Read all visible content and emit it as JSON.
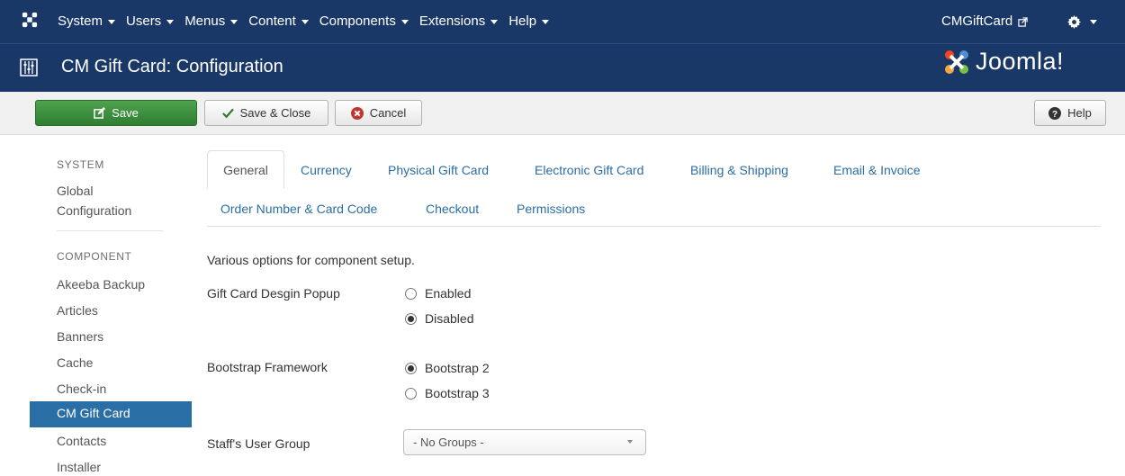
{
  "topnav": {
    "menu": [
      {
        "label": "System"
      },
      {
        "label": "Users"
      },
      {
        "label": "Menus"
      },
      {
        "label": "Content"
      },
      {
        "label": "Components"
      },
      {
        "label": "Extensions"
      },
      {
        "label": "Help"
      }
    ],
    "user_label": "CMGiftCard"
  },
  "titlebar": {
    "title": "CM Gift Card: Configuration",
    "brand": "Joomla!"
  },
  "toolbar": {
    "save_label": "Save",
    "save_close_label": "Save & Close",
    "cancel_label": "Cancel",
    "help_label": "Help"
  },
  "sidebar": {
    "system_heading": "SYSTEM",
    "global_config": [
      "Global",
      "Configuration"
    ],
    "component_heading": "COMPONENT",
    "items": [
      "Akeeba Backup",
      "Articles",
      "Banners",
      "Cache",
      "Check-in",
      "CM Gift Card",
      "Contacts",
      "Installer"
    ]
  },
  "tabs": {
    "row1": [
      "General",
      "Currency",
      "Physical Gift Card",
      "Electronic Gift Card",
      "Billing & Shipping",
      "Email & Invoice"
    ],
    "row2": [
      "Order Number & Card Code",
      "Checkout",
      "Permissions"
    ]
  },
  "form": {
    "description": "Various options for component setup.",
    "popup_label": "Gift Card Desgin Popup",
    "popup_options": [
      "Enabled",
      "Disabled"
    ],
    "popup_selected": "Disabled",
    "bootstrap_label": "Bootstrap Framework",
    "bootstrap_options": [
      "Bootstrap 2",
      "Bootstrap 3"
    ],
    "bootstrap_selected": "Bootstrap 2",
    "staff_group_label": "Staff's User Group",
    "staff_group_value": "- No Groups -"
  },
  "colors": {
    "nav_bg": "#1a3867",
    "save_green": "#3c8e3f",
    "link_blue": "#2a6ea6",
    "active_sidebar": "#2a6ea6"
  }
}
